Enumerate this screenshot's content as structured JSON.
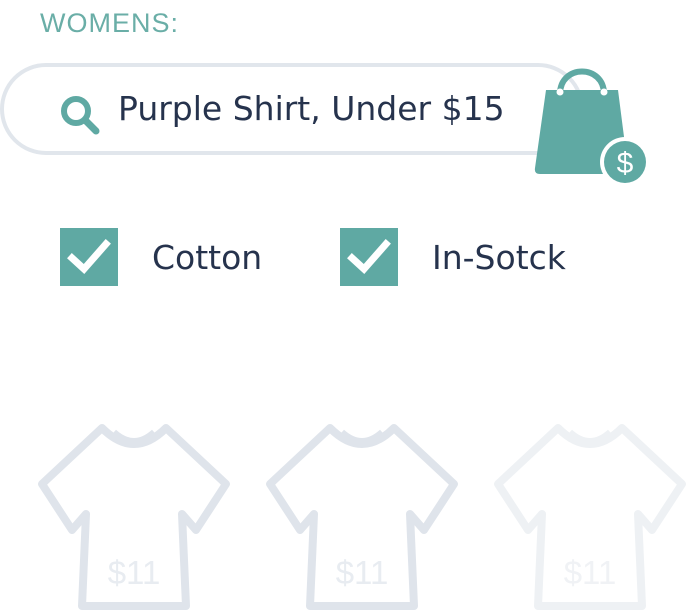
{
  "header": {
    "category_label": "WOMENS:"
  },
  "search": {
    "query": "Purple Shirt, Under $15",
    "icon": "search-icon"
  },
  "cart": {
    "icon": "shopping-bag-dollar-icon"
  },
  "filters": [
    {
      "label": "Cotton",
      "checked": true
    },
    {
      "label": "In-Sotck",
      "checked": true
    }
  ],
  "products": [
    {
      "price": "$11",
      "icon": "tshirt-icon"
    },
    {
      "price": "$11",
      "icon": "tshirt-icon"
    },
    {
      "price": "$11",
      "icon": "tshirt-icon"
    }
  ],
  "colors": {
    "accent": "#5fa9a3",
    "heading": "#6aaea7",
    "text": "#26334d",
    "outline": "#dfe4eb"
  }
}
